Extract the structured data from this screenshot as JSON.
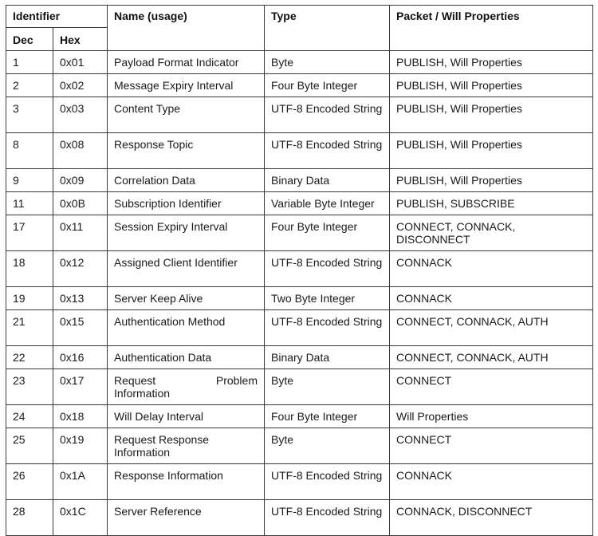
{
  "table": {
    "headers": {
      "identifier": "Identifier",
      "dec": "Dec",
      "hex": "Hex",
      "name": "Name (usage)",
      "type": "Type",
      "packet": "Packet / Will Properties"
    },
    "rows": [
      {
        "dec": "1",
        "hex": "0x01",
        "name": "Payload Format Indicator",
        "type": "Byte",
        "packet": "PUBLISH, Will Properties"
      },
      {
        "dec": "2",
        "hex": "0x02",
        "name": "Message Expiry Interval",
        "type": "Four Byte Integer",
        "packet": "PUBLISH, Will Properties"
      },
      {
        "dec": "3",
        "hex": "0x03",
        "name": "Content Type",
        "type": "UTF-8 Encoded String",
        "packet": "PUBLISH, Will Properties"
      },
      {
        "dec": "8",
        "hex": "0x08",
        "name": "Response Topic",
        "type": "UTF-8 Encoded String",
        "packet": "PUBLISH, Will Properties"
      },
      {
        "dec": "9",
        "hex": "0x09",
        "name": "Correlation Data",
        "type": "Binary Data",
        "packet": "PUBLISH, Will Properties"
      },
      {
        "dec": "11",
        "hex": "0x0B",
        "name": "Subscription Identifier",
        "type": "Variable Byte Integer",
        "packet": "PUBLISH, SUBSCRIBE"
      },
      {
        "dec": "17",
        "hex": "0x11",
        "name": "Session Expiry Interval",
        "type": "Four Byte Integer",
        "packet": "CONNECT, CONNACK, DISCONNECT"
      },
      {
        "dec": "18",
        "hex": "0x12",
        "name": "Assigned Client Identifier",
        "type": "UTF-8 Encoded String",
        "packet": "CONNACK"
      },
      {
        "dec": "19",
        "hex": "0x13",
        "name": "Server Keep Alive",
        "type": "Two Byte Integer",
        "packet": "CONNACK"
      },
      {
        "dec": "21",
        "hex": "0x15",
        "name": "Authentication Method",
        "type": "UTF-8 Encoded String",
        "packet": "CONNECT, CONNACK, AUTH"
      },
      {
        "dec": "22",
        "hex": "0x16",
        "name": "Authentication Data",
        "type": "Binary Data",
        "packet": "CONNECT, CONNACK, AUTH"
      },
      {
        "dec": "23",
        "hex": "0x17",
        "name": "Request Problem Information",
        "name_line1_left": "Request",
        "name_line1_right": "Problem",
        "name_line2": "Information",
        "type": "Byte",
        "packet": "CONNECT"
      },
      {
        "dec": "24",
        "hex": "0x18",
        "name": "Will Delay Interval",
        "type": "Four Byte Integer",
        "packet": "Will Properties"
      },
      {
        "dec": "25",
        "hex": "0x19",
        "name": "Request Response Information",
        "type": "Byte",
        "packet": "CONNECT"
      },
      {
        "dec": "26",
        "hex": "0x1A",
        "name": "Response Information",
        "type": "UTF-8 Encoded String",
        "packet": "CONNACK"
      },
      {
        "dec": "28",
        "hex": "0x1C",
        "name": "Server Reference",
        "type": "UTF-8 Encoded String",
        "packet": "CONNACK, DISCONNECT"
      }
    ]
  }
}
